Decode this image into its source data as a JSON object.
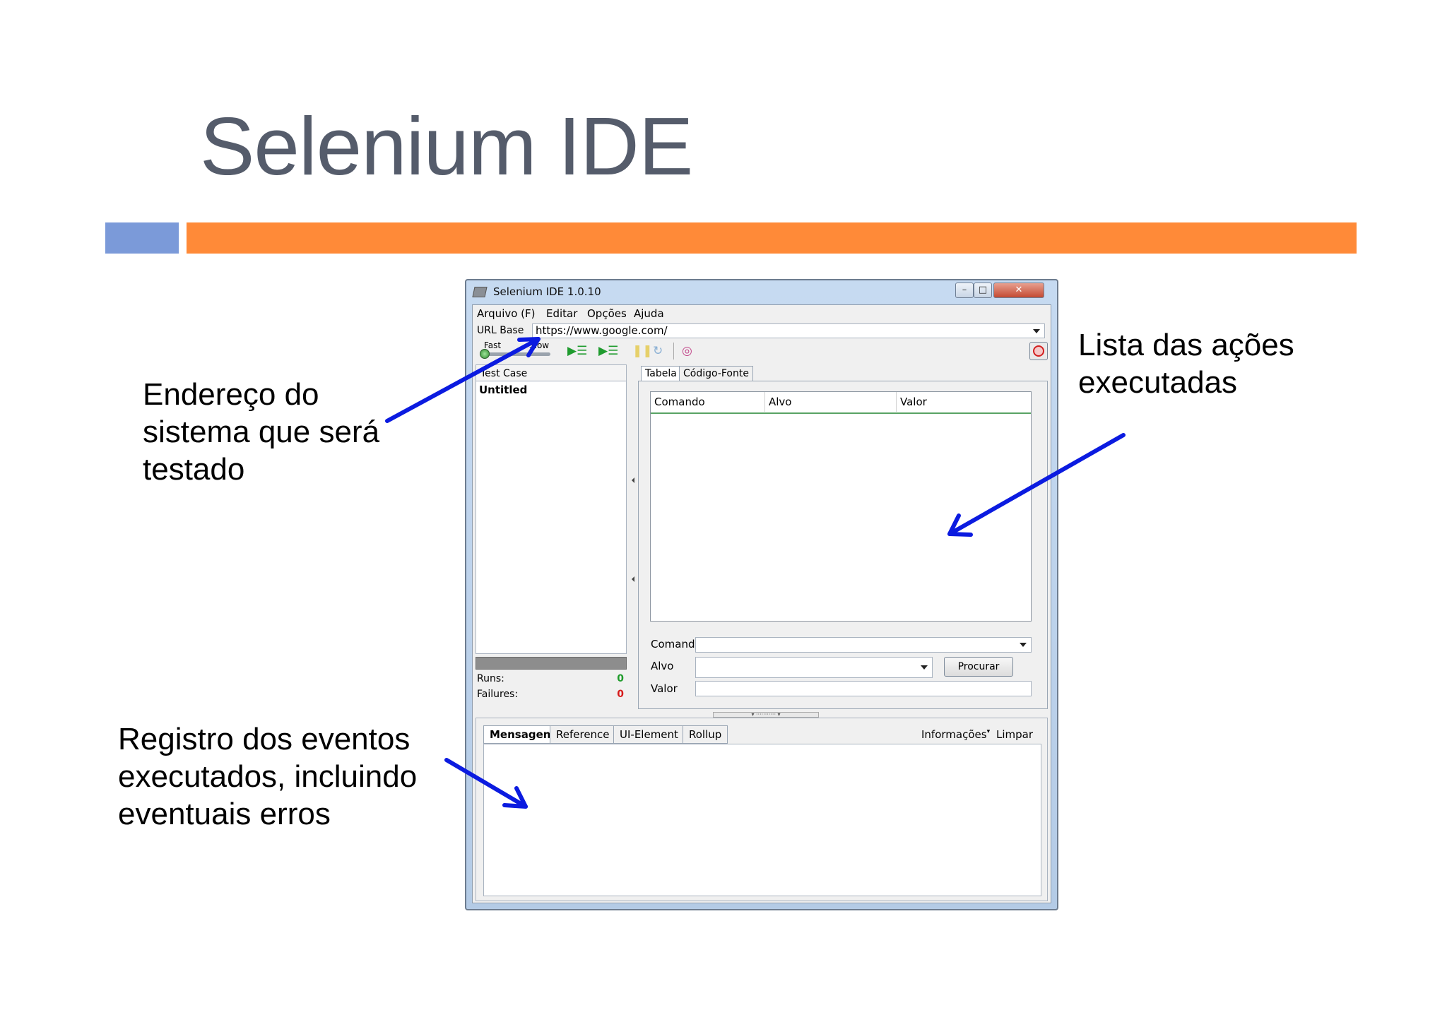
{
  "slide": {
    "title": "Selenium IDE",
    "callouts": {
      "address": [
        "Endereço do",
        "sistema que será",
        "testado"
      ],
      "actions": [
        "Lista das ações",
        "executadas"
      ],
      "events": [
        "Registro dos eventos",
        "executados, incluindo",
        "eventuais erros"
      ]
    },
    "colors": {
      "title": "#555c6b",
      "accent_blue": "#7b9ad9",
      "accent_orange": "#ff8a38",
      "arrow": "#0b1be0"
    }
  },
  "window": {
    "title": "Selenium IDE 1.0.10",
    "controls": {
      "minimize": "–",
      "maximize": "□",
      "close": "✕"
    },
    "menu": [
      "Arquivo (F)",
      "Editar",
      "Opções",
      "Ajuda"
    ],
    "url_bar": {
      "label": "URL Base",
      "value": "https://www.google.com/"
    },
    "toolbar": {
      "speed_fast": "Fast",
      "speed_slow": "Slow",
      "icons": [
        "play-all-icon",
        "play-current-icon",
        "pause-icon",
        "step-icon",
        "rollup-icon",
        "record-icon"
      ]
    },
    "test_case_panel": {
      "header": "Test Case",
      "items": [
        "Untitled"
      ],
      "runs_label": "Runs:",
      "runs_value": "0",
      "failures_label": "Failures:",
      "failures_value": "0"
    },
    "editor": {
      "tabs": [
        "Tabela",
        "Código-Fonte"
      ],
      "active_tab": "Tabela",
      "columns": [
        "Comando",
        "Alvo",
        "Valor"
      ],
      "fields": {
        "command": "Comando",
        "target": "Alvo",
        "value": "Valor"
      },
      "find_button": "Procurar"
    },
    "log_panel": {
      "tabs": [
        "Mensagens",
        "Reference",
        "UI-Element",
        "Rollup"
      ],
      "active_tab": "Mensagens",
      "info_menu": "Informações",
      "clear": "Limpar"
    }
  }
}
